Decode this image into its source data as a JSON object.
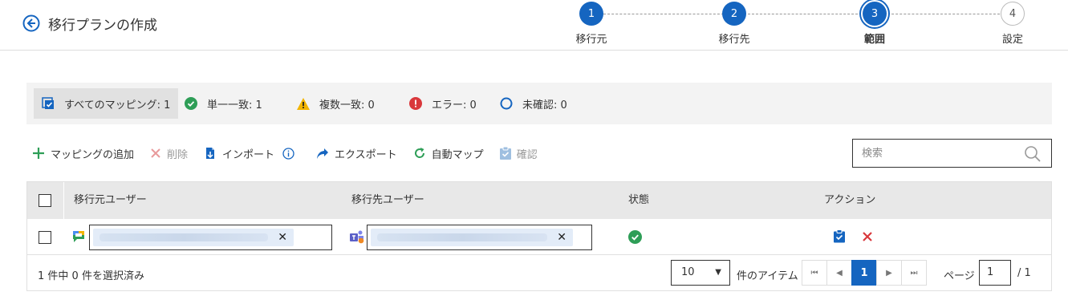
{
  "header": {
    "title": "移行プランの作成",
    "steps": [
      {
        "number": "1",
        "label": "移行元",
        "state": "done"
      },
      {
        "number": "2",
        "label": "移行先",
        "state": "done"
      },
      {
        "number": "3",
        "label": "範囲",
        "state": "active"
      },
      {
        "number": "4",
        "label": "設定",
        "state": "todo"
      }
    ]
  },
  "filters": [
    {
      "label": "すべてのマッピング: 1",
      "icon": "select-all-icon",
      "selected": true
    },
    {
      "label": "単一一致: 1",
      "icon": "check-circle-icon",
      "color": "#2e9e57"
    },
    {
      "label": "複数一致: 0",
      "icon": "warning-icon",
      "color": "#f2b400"
    },
    {
      "label": "エラー: 0",
      "icon": "error-icon",
      "color": "#d9373b"
    },
    {
      "label": "未確認: 0",
      "icon": "circle-outline-icon",
      "color": "#1565c0"
    }
  ],
  "toolbar": {
    "add_label": "マッピングの追加",
    "delete_label": "削除",
    "import_label": "インポート",
    "export_label": "エクスポート",
    "automap_label": "自動マップ",
    "confirm_label": "確認"
  },
  "search": {
    "placeholder": "検索"
  },
  "table": {
    "columns": [
      "移行元ユーザー",
      "移行先ユーザー",
      "状態",
      "アクション"
    ],
    "rows": [
      {
        "source_icon": "google-chat-icon",
        "target_icon": "teams-icon",
        "status": "check-circle-icon"
      }
    ]
  },
  "footer": {
    "selection": "1 件中 0 件を選択済み",
    "page_size": "10",
    "items_label": "件のアイテム",
    "current_page": "1",
    "page_label": "ページ",
    "page_input": "1",
    "page_total": "/ 1"
  },
  "colors": {
    "accent": "#1565c0",
    "success": "#2e9e57",
    "danger": "#d9373b",
    "warning": "#f2b400"
  }
}
